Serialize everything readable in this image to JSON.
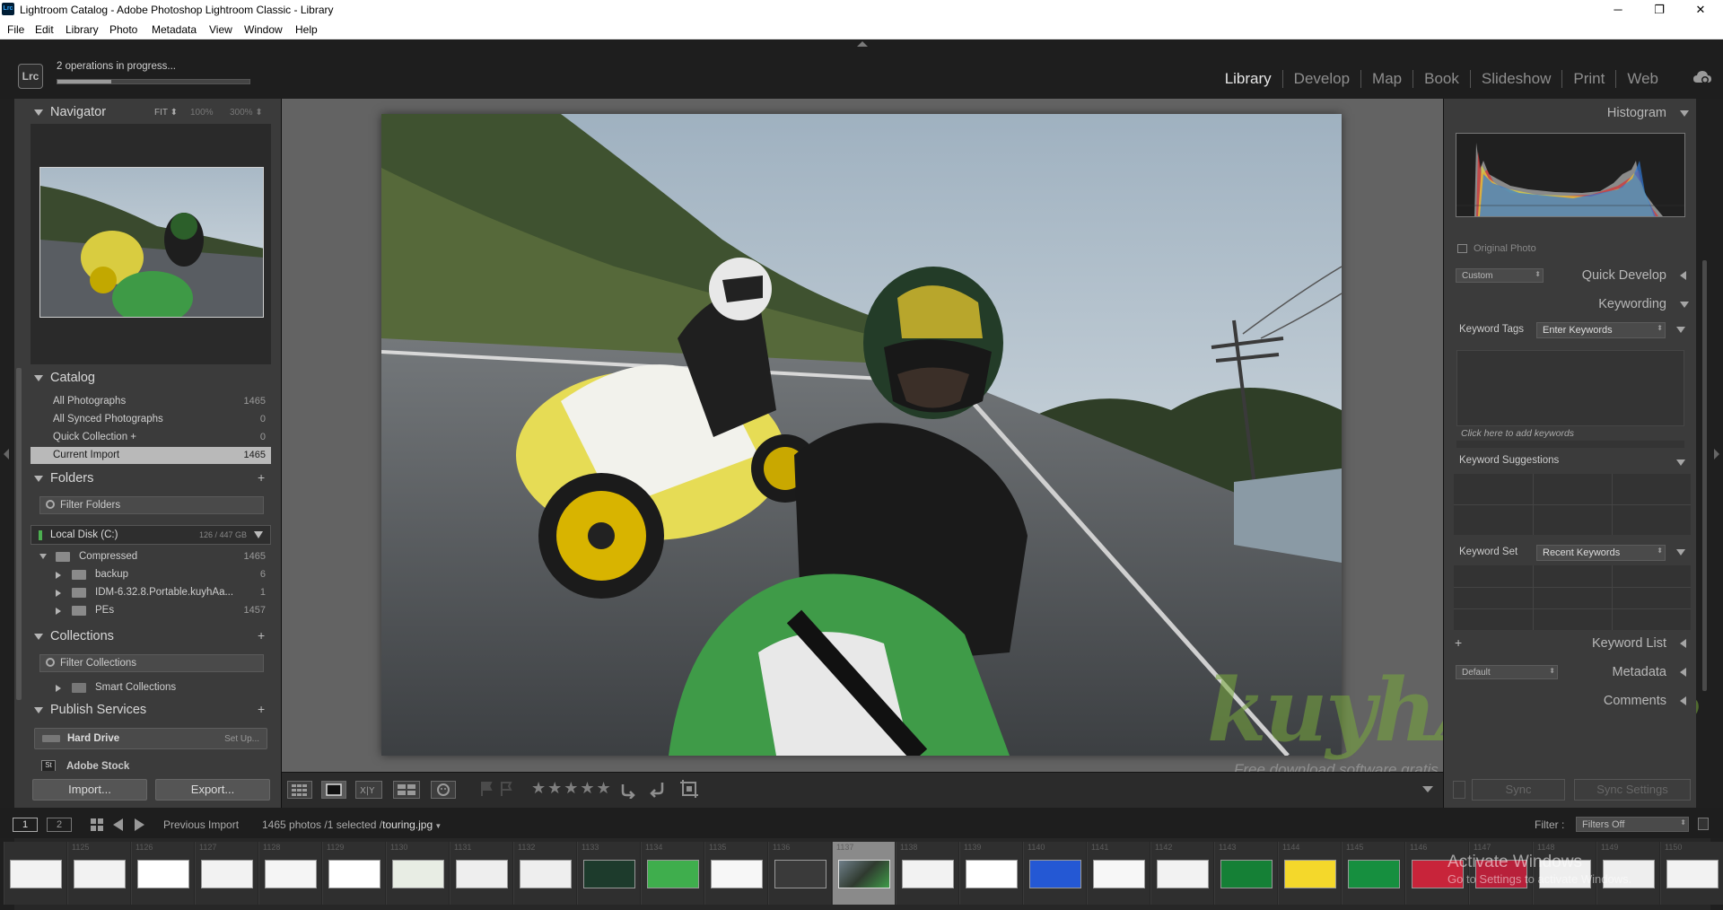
{
  "window": {
    "title": "Lightroom Catalog - Adobe Photoshop Lightroom Classic - Library",
    "app_icon": "Lrc",
    "minimize": "─",
    "maximize": "❐",
    "close": "✕"
  },
  "menu": [
    "File",
    "Edit",
    "Library",
    "Photo",
    "Metadata",
    "View",
    "Window",
    "Help"
  ],
  "identity": {
    "logo": "Lrc",
    "operations": "2 operations in progress...",
    "progress": 0.28
  },
  "modules": [
    "Library",
    "Develop",
    "Map",
    "Book",
    "Slideshow",
    "Print",
    "Web"
  ],
  "active_module": "Library",
  "navigator": {
    "title": "Navigator",
    "zoom_options": [
      "FIT ⬍",
      "100%",
      "300% ⬍"
    ]
  },
  "catalog": {
    "title": "Catalog",
    "items": [
      {
        "label": "All Photographs",
        "count": "1465"
      },
      {
        "label": "All Synced Photographs",
        "count": "0"
      },
      {
        "label": "Quick Collection +",
        "count": "0"
      },
      {
        "label": "Current Import",
        "count": "1465"
      }
    ]
  },
  "folders": {
    "title": "Folders",
    "filter": "Filter Folders",
    "disk_label": "Local Disk (C:)",
    "disk_size": "126 / 447 GB",
    "items": [
      {
        "label": "Compressed",
        "count": "1465"
      },
      {
        "label": "backup",
        "count": "6"
      },
      {
        "label": "IDM-6.32.8.Portable.kuyhAa...",
        "count": "1"
      },
      {
        "label": "PEs",
        "count": "1457"
      }
    ]
  },
  "collections": {
    "title": "Collections",
    "filter": "Filter Collections",
    "smart": "Smart Collections"
  },
  "publish": {
    "title": "Publish Services",
    "hard_drive": "Hard Drive",
    "setup": "Set Up...",
    "adobe_stock": "Adobe Stock"
  },
  "buttons": {
    "import": "Import...",
    "export": "Export...",
    "sync": "Sync",
    "sync_settings": "Sync Settings"
  },
  "right": {
    "histogram": "Histogram",
    "original_photo": "Original Photo",
    "quick_develop": "Quick Develop",
    "preset": "Custom",
    "keywording": "Keywording",
    "keyword_tags": "Keyword Tags",
    "enter_keywords": "Enter Keywords",
    "click_here": "Click here to add keywords",
    "keyword_suggestions": "Keyword Suggestions",
    "keyword_set": "Keyword Set",
    "recent_keywords": "Recent Keywords",
    "keyword_list": "Keyword List",
    "metadata_preset": "Default",
    "metadata": "Metadata",
    "comments": "Comments"
  },
  "filmbar": {
    "page1": "1",
    "page2": "2",
    "source": "Previous Import",
    "info": "1465 photos /1 selected /",
    "filename": "touring.jpg",
    "filter_label": "Filter :",
    "filter_value": "Filters Off"
  },
  "filmstrip": {
    "numbers": [
      "1125",
      "1126",
      "1127",
      "1128",
      "1129",
      "1130",
      "1131",
      "1132",
      "1133",
      "1134",
      "1135",
      "1136",
      "1137",
      "1138",
      "1139",
      "1140",
      "1141",
      "1142",
      "1143",
      "1144",
      "1145",
      "1146",
      "1147",
      "1148",
      "1149",
      "1150"
    ],
    "selected_index": 12
  },
  "watermark": {
    "brand": "kuyhAaMe",
    "tagline": "Free download software gratis"
  },
  "activation": {
    "line1": "Activate Windows",
    "line2": "Go to Settings to activate Windows."
  }
}
